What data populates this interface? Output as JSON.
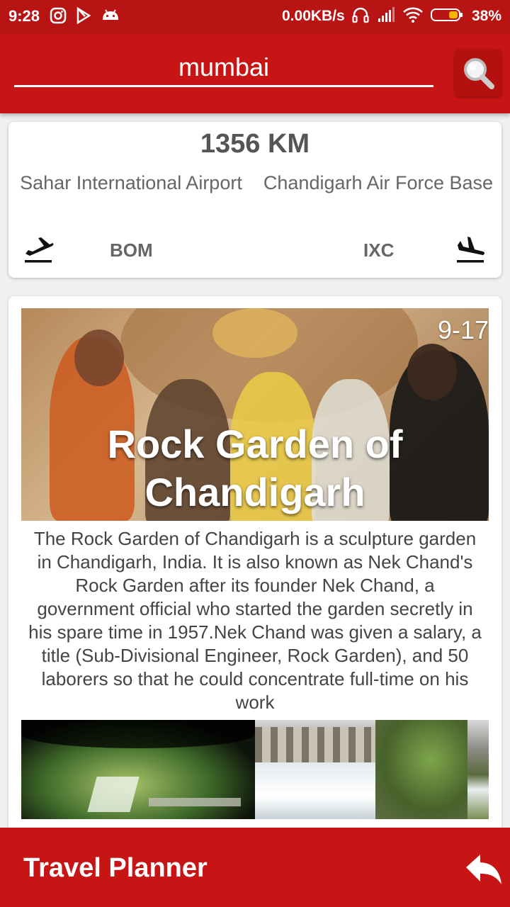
{
  "status_bar": {
    "time": "9:28",
    "network_speed": "0.00KB/s",
    "battery": "38%"
  },
  "search": {
    "value": "mumbai"
  },
  "route": {
    "distance": "1356 KM",
    "origin": {
      "name": "Sahar International Airport",
      "code": "BOM"
    },
    "destination": {
      "name": "Chandigarh Air Force Base",
      "code": "IXC"
    }
  },
  "place": {
    "counter": "9-17",
    "title": "Rock Garden of Chandigarh",
    "description": "The Rock Garden of Chandigarh is a sculpture garden in Chandigarh, India. It is also known as Nek Chand's Rock Garden after its founder Nek Chand, a government official who started the garden secretly in his spare time in 1957.Nek Chand was given a salary, a title (Sub-Divisional Engineer, Rock Garden), and 50 laborers so that he could concentrate full-time on his work"
  },
  "bottom_bar": {
    "title": "Travel Planner"
  },
  "icons": {
    "status": [
      "instagram-icon",
      "play-store-icon",
      "android-icon",
      "headphones-icon",
      "signal-icon",
      "wifi-icon",
      "battery-icon"
    ],
    "search": "search-icon",
    "departure": "flight-takeoff-icon",
    "arrival": "flight-land-icon",
    "back": "reply-arrow-icon"
  },
  "colors": {
    "primary": "#c71414",
    "status_bar": "#b81414",
    "battery_fill": "#f5b400"
  }
}
